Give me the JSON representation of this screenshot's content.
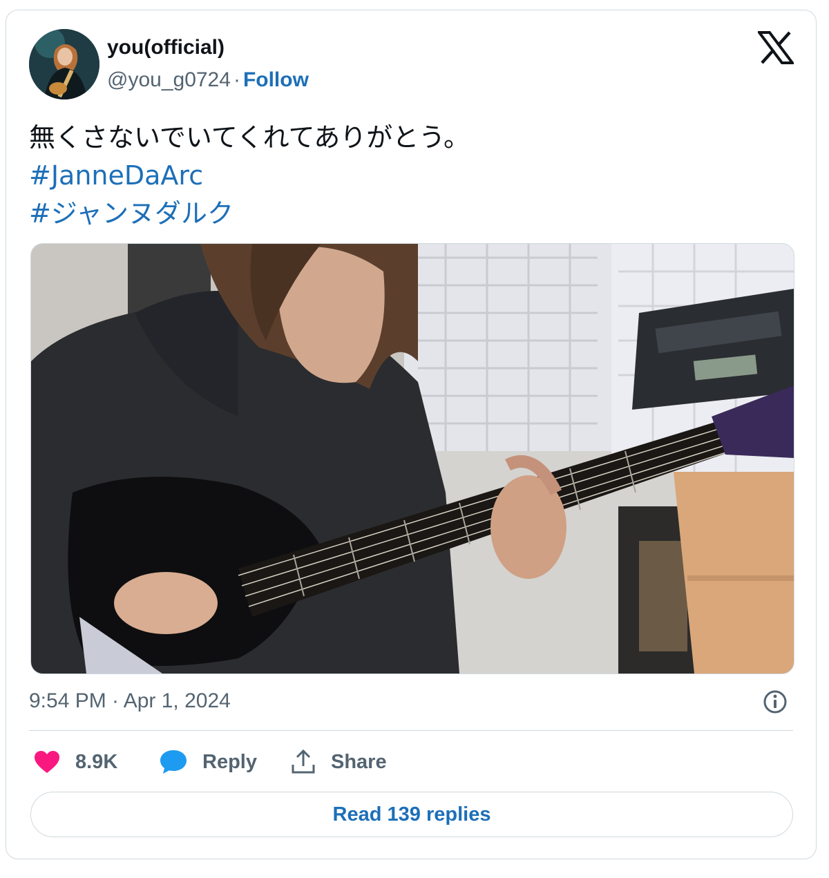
{
  "author": {
    "name": "you(official)",
    "handle": "@you_g0724",
    "separator": "·",
    "follow_label": "Follow"
  },
  "tweet": {
    "text": "無くさないでいてくれてありがとう。",
    "hashtags": [
      "#JanneDaArc",
      "#ジャンヌダルク"
    ]
  },
  "timestamp": "9:54 PM · Apr 1, 2024",
  "actions": {
    "like_count": "8.9K",
    "reply_label": "Reply",
    "share_label": "Share"
  },
  "read_replies_label": "Read 139 replies",
  "icons": {
    "logo": "x-logo-icon",
    "like": "heart-icon",
    "reply": "speech-bubble-icon",
    "share": "share-upload-icon",
    "info": "info-icon"
  },
  "colors": {
    "link": "#1d6fb8",
    "like": "#f91880",
    "reply": "#1d9bf0",
    "secondary_text": "#536471",
    "border": "#cfd9de"
  }
}
